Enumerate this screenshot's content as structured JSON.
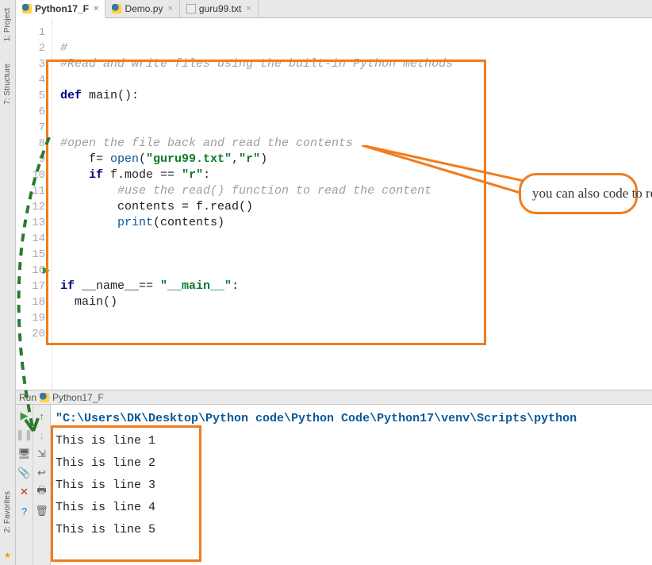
{
  "rail": {
    "project": "1: Project",
    "structure": "7: Structure",
    "favorites": "2: Favorites"
  },
  "tabs": [
    {
      "label": "Python17_F",
      "active": true,
      "kind": "py"
    },
    {
      "label": "Demo.py",
      "active": false,
      "kind": "py"
    },
    {
      "label": "guru99.txt",
      "active": false,
      "kind": "txt"
    }
  ],
  "gutter_lines": [
    "1",
    "2",
    "3",
    "4",
    "5",
    "6",
    "7",
    "8",
    "9",
    "10",
    "11",
    "12",
    "13",
    "14",
    "15",
    "16",
    "17",
    "18",
    "19",
    "20"
  ],
  "code": {
    "l1": "#",
    "l2": "#Read and write files using the built-in Python methods",
    "l4_def": "def",
    "l4_name": " main():",
    "l7": "#open the file back and read the contents",
    "l8_a": "    f= ",
    "l8_open": "open",
    "l8_p1": "(",
    "l8_s1": "\"guru99.txt\"",
    "l8_c": ",",
    "l8_s2": "\"r\"",
    "l8_p2": ")",
    "l9_if": "if",
    "l9_rest": " f.mode == ",
    "l9_s": "\"r\"",
    "l9_colon": ":",
    "l10": "#use the read() function to read the content",
    "l11": "        contents = f.read()",
    "l12a": "        ",
    "l12_print": "print",
    "l12b": "(contents)",
    "l16_if": "if",
    "l16_rest": " __name__== ",
    "l16_s": "\"__main__\"",
    "l16_colon": ":",
    "l17": "  main()"
  },
  "callout": "you can also code to read the content of your .txt file",
  "run": {
    "label": "Run",
    "target": "Python17_F"
  },
  "console": {
    "cmd": "\"C:\\Users\\DK\\Desktop\\Python code\\Python Code\\Python17\\venv\\Scripts\\python",
    "lines": [
      "This is line 1",
      "This is line 2",
      "This is line 3",
      "This is line 4",
      "This is line 5"
    ]
  }
}
